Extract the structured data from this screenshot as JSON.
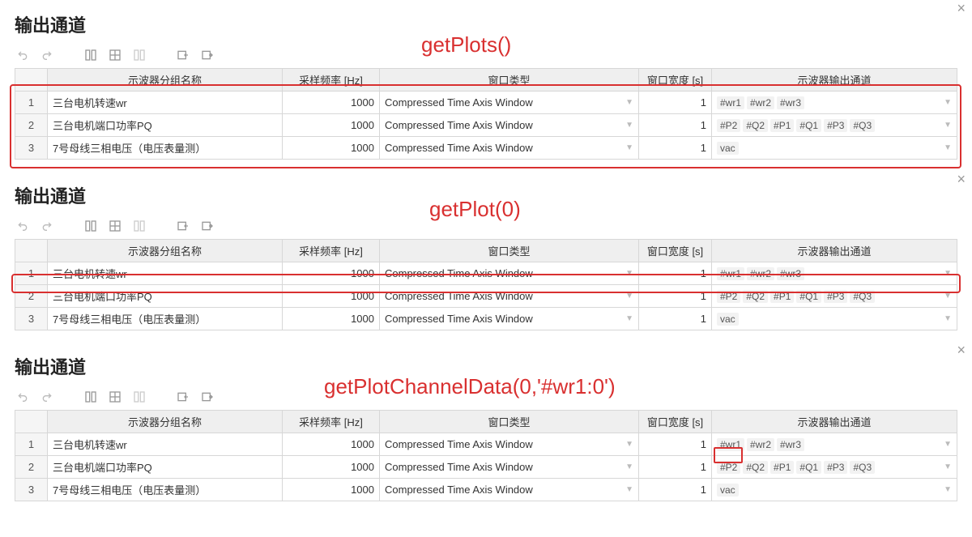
{
  "common": {
    "panel_title": "输出通道",
    "columns": {
      "name": "示波器分组名称",
      "freq": "采样频率 [Hz]",
      "wtype": "窗口类型",
      "width": "窗口宽度 [s]",
      "chan": "示波器输出通道"
    },
    "rows": [
      {
        "idx": "1",
        "name": "三台电机转速wr",
        "freq": "1000",
        "wtype": "Compressed Time Axis Window",
        "width": "1",
        "chan_tags": [
          "#wr1",
          "#wr2",
          "#wr3"
        ]
      },
      {
        "idx": "2",
        "name": "三台电机端口功率PQ",
        "freq": "1000",
        "wtype": "Compressed Time Axis Window",
        "width": "1",
        "chan_tags": [
          "#P2",
          "#Q2",
          "#P1",
          "#Q1",
          "#P3",
          "#Q3"
        ]
      },
      {
        "idx": "3",
        "name": "7号母线三相电压（电压表量测）",
        "freq": "1000",
        "wtype": "Compressed Time Axis Window",
        "width": "1",
        "chan_tags": [
          "vac"
        ]
      }
    ]
  },
  "annotations": {
    "a1": "getPlots()",
    "a2": "getPlot(0)",
    "a3": "getPlotChannelData(0,'#wr1:0')"
  }
}
